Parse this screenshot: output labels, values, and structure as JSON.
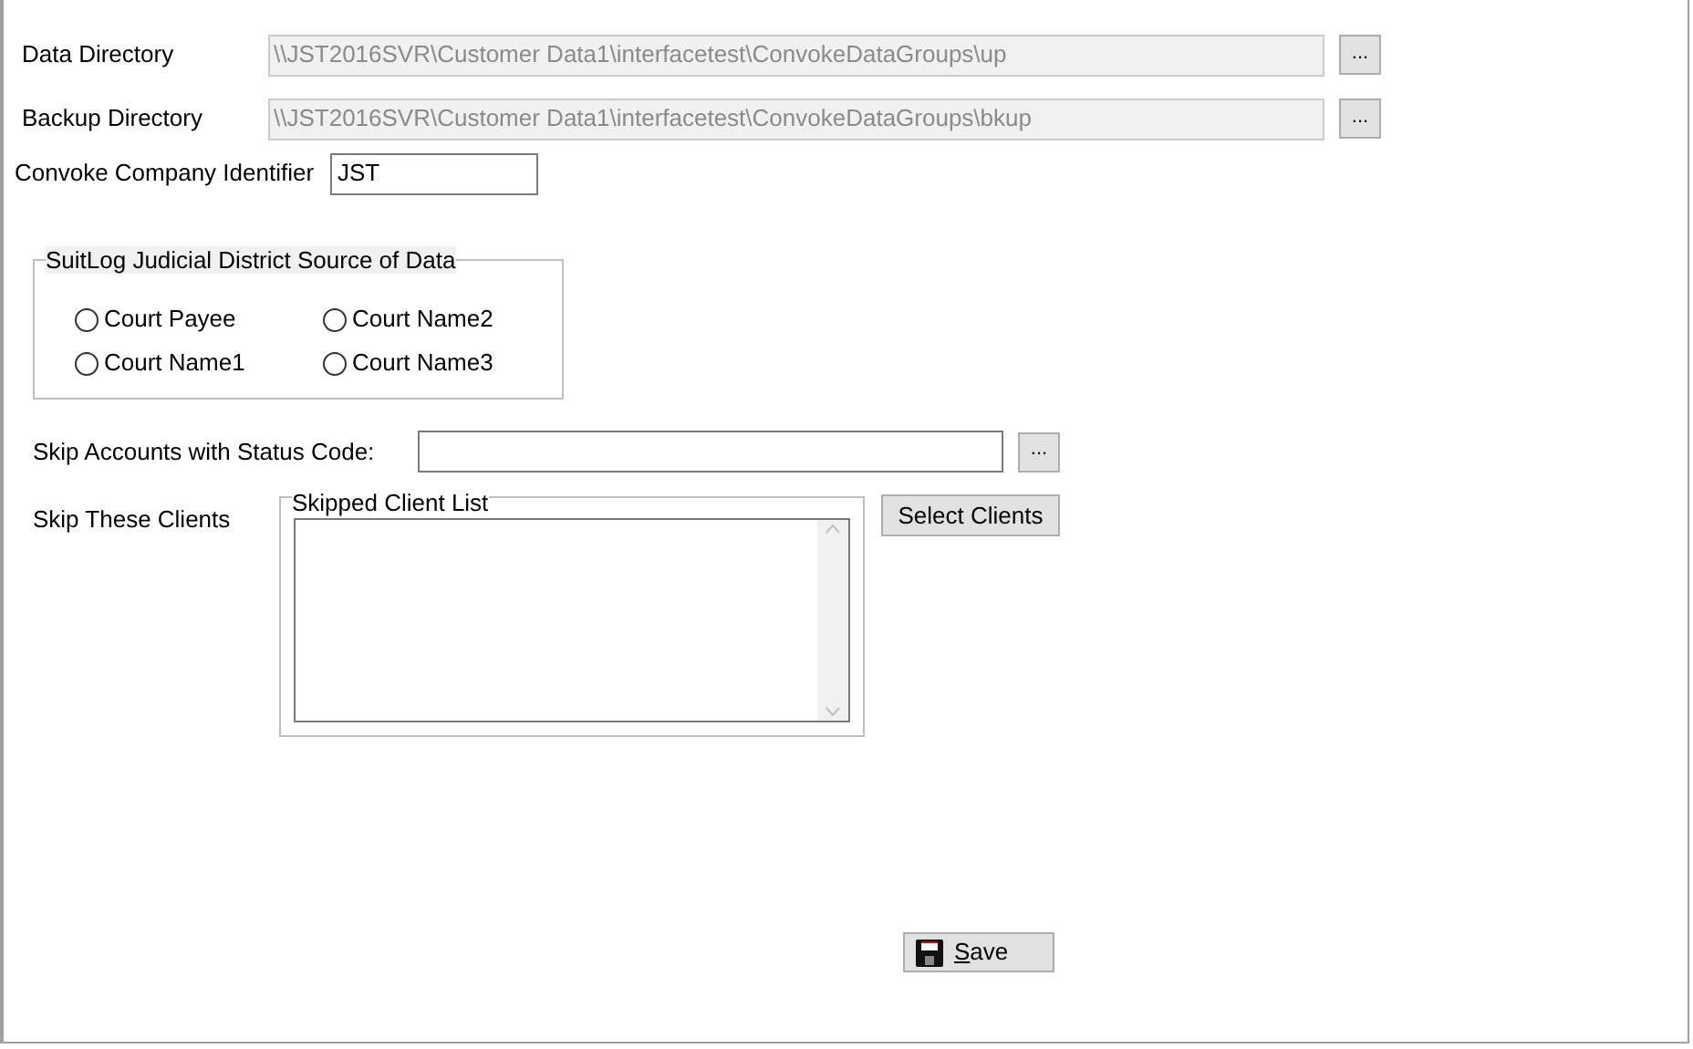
{
  "data_directory": {
    "label": "Data Directory",
    "value": "\\\\JST2016SVR\\Customer Data1\\interfacetest\\ConvokeDataGroups\\up",
    "browse": "...",
    "disabled": true
  },
  "backup_directory": {
    "label": "Backup Directory",
    "value": "\\\\JST2016SVR\\Customer Data1\\interfacetest\\ConvokeDataGroups\\bkup",
    "browse": "...",
    "disabled": true
  },
  "company_identifier": {
    "label": "Convoke Company Identifier",
    "value": "JST"
  },
  "source_group": {
    "title": "SuitLog Judicial District Source of Data",
    "options": [
      {
        "label": "Court Payee",
        "selected": false
      },
      {
        "label": "Court Name2",
        "selected": false
      },
      {
        "label": "Court Name1",
        "selected": false
      },
      {
        "label": "Court Name3",
        "selected": false
      }
    ]
  },
  "skip_status": {
    "label": "Skip Accounts with Status Code:",
    "browse": "..."
  },
  "skip_clients": {
    "label": "Skip These Clients",
    "group_title": "Skipped Client List",
    "button": "Select Clients"
  },
  "save_button": {
    "label": "Save"
  }
}
